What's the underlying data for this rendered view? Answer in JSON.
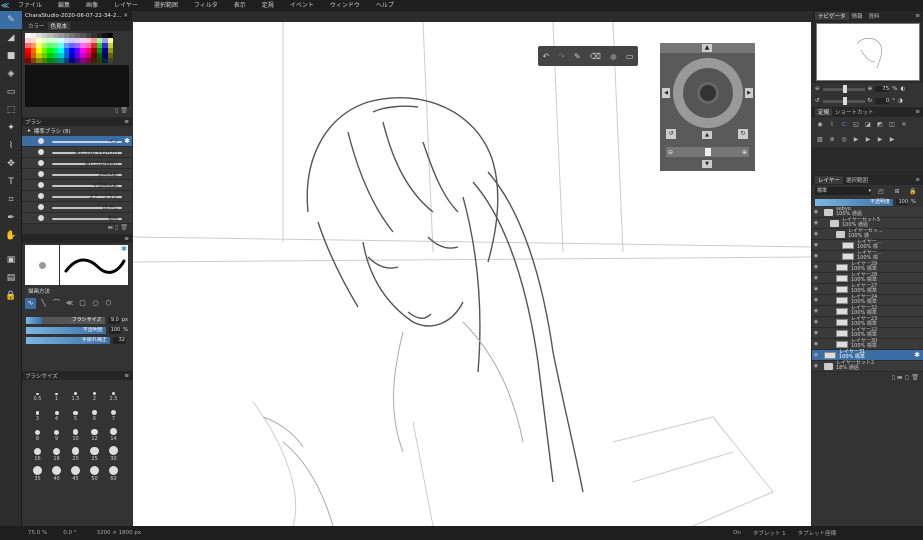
{
  "app": {
    "logo": "≪"
  },
  "menu": [
    "ファイル",
    "編集",
    "画像",
    "レイヤー",
    "選択範囲",
    "フィルタ",
    "表示",
    "定規",
    "イベント",
    "ウィンドウ",
    "ヘルプ"
  ],
  "document_tab": {
    "title": "CharaStudio-2020-06-07-22-34-2...",
    "close": "✕"
  },
  "tools": [
    {
      "name": "pen-tool-icon",
      "glyph": "✎",
      "active": true
    },
    {
      "name": "eraser-tool-icon",
      "glyph": "◢"
    },
    {
      "name": "shape-tool-icon",
      "glyph": "■"
    },
    {
      "name": "fill-tool-icon",
      "glyph": "◈"
    },
    {
      "name": "gradient-tool-icon",
      "glyph": "▭"
    },
    {
      "name": "select-tool-icon",
      "glyph": "⬚"
    },
    {
      "name": "magic-wand-tool-icon",
      "glyph": "✦"
    },
    {
      "name": "lasso-tool-icon",
      "glyph": "⌇"
    },
    {
      "name": "move-tool-icon",
      "glyph": "✥"
    },
    {
      "name": "text-tool-icon",
      "glyph": "T"
    },
    {
      "name": "crop-tool-icon",
      "glyph": "⌗"
    },
    {
      "name": "eyedropper-tool-icon",
      "glyph": "✒"
    },
    {
      "name": "hand-tool-icon",
      "glyph": "✋"
    }
  ],
  "tool_bottom": [
    {
      "name": "layer-mode-icon",
      "glyph": "▣"
    },
    {
      "name": "mask-mode-icon",
      "glyph": "▤"
    },
    {
      "name": "lock-icon",
      "glyph": "🔒"
    }
  ],
  "color_panel": {
    "tabs": [
      "カラー",
      "色見本"
    ]
  },
  "brush_panel": {
    "title": "ブラシ",
    "group": "標準ブラシ (8)",
    "items": [
      "ペン",
      "消しゴム(やわらか)",
      "消しゴム(硬め)",
      "透明水彩",
      "不透明水彩",
      "エアーブラシ",
      "ぼかし",
      "指先"
    ]
  },
  "brush_settings": {
    "draw_method_label": "描画方法",
    "sliders": [
      {
        "label": "ブラシサイズ",
        "value": "9.0",
        "unit": "px",
        "fill": 0.2
      },
      {
        "label": "不透明度",
        "value": "100",
        "unit": "%",
        "fill": 1.0
      },
      {
        "label": "手振れ補正",
        "value": "32",
        "unit": "",
        "fill": 1.0
      }
    ]
  },
  "brush_size_panel": {
    "title": "ブラシサイズ",
    "sizes": [
      "0.5",
      "1",
      "1.5",
      "2",
      "2.5",
      "3",
      "4",
      "5",
      "6",
      "7",
      "8",
      "9",
      "10",
      "12",
      "14",
      "16",
      "18",
      "20",
      "25",
      "30",
      "35",
      "40",
      "45",
      "50",
      "60"
    ]
  },
  "navigator": {
    "tabs": [
      "ナビゲータ",
      "情報",
      "資料"
    ],
    "zoom": "75",
    "zoom_unit": "%",
    "angle": "0",
    "angle_unit": "°"
  },
  "ruler_panel": {
    "tabs": [
      "定規",
      "ショートカット"
    ]
  },
  "layers_panel": {
    "tabs": [
      "レイヤー",
      "選択範囲"
    ],
    "blend_mode": "標準",
    "opacity_label": "不透明度",
    "opacity_value": "100",
    "opacity_unit": "%",
    "layers": [
      {
        "name": "sebyo",
        "sub": "100% 通過",
        "type": "folder",
        "indent": 0
      },
      {
        "name": "レイヤーセット5",
        "sub": "100% 通過",
        "type": "folder",
        "indent": 1
      },
      {
        "name": "レイヤーセッ...",
        "sub": "100% 通",
        "type": "folder",
        "indent": 2
      },
      {
        "name": "レイヤー...",
        "sub": "100% 標",
        "type": "layer",
        "indent": 3
      },
      {
        "name": "レイヤー...",
        "sub": "100% 標",
        "type": "layer",
        "indent": 3
      },
      {
        "name": "レイヤー29",
        "sub": "100% 標準",
        "type": "layer",
        "indent": 2
      },
      {
        "name": "レイヤー28",
        "sub": "100% 標準",
        "type": "layer",
        "indent": 2
      },
      {
        "name": "レイヤー27",
        "sub": "100% 標準",
        "type": "layer",
        "indent": 2
      },
      {
        "name": "レイヤー24",
        "sub": "100% 標準",
        "type": "layer",
        "indent": 2
      },
      {
        "name": "レイヤー32",
        "sub": "100% 標準",
        "type": "layer",
        "indent": 2
      },
      {
        "name": "レイヤー23",
        "sub": "100% 標準",
        "type": "layer",
        "indent": 2
      },
      {
        "name": "レイヤー22",
        "sub": "100% 標準",
        "type": "layer",
        "indent": 2
      },
      {
        "name": "レイヤー30",
        "sub": "100% 標準",
        "type": "layer",
        "indent": 2
      },
      {
        "name": "レイヤー31",
        "sub": "100% 標準",
        "type": "layer",
        "indent": 0,
        "selected": true
      },
      {
        "name": "レイヤーセット2",
        "sub": "18% 通過",
        "type": "folder",
        "indent": 0
      }
    ]
  },
  "status": {
    "zoom": "75.0 %",
    "angle": "0.0 °",
    "size": "3200 × 1800 px",
    "on": "On",
    "tablet1": "タブレット 1",
    "tablet_mode": "タブレット座標"
  }
}
